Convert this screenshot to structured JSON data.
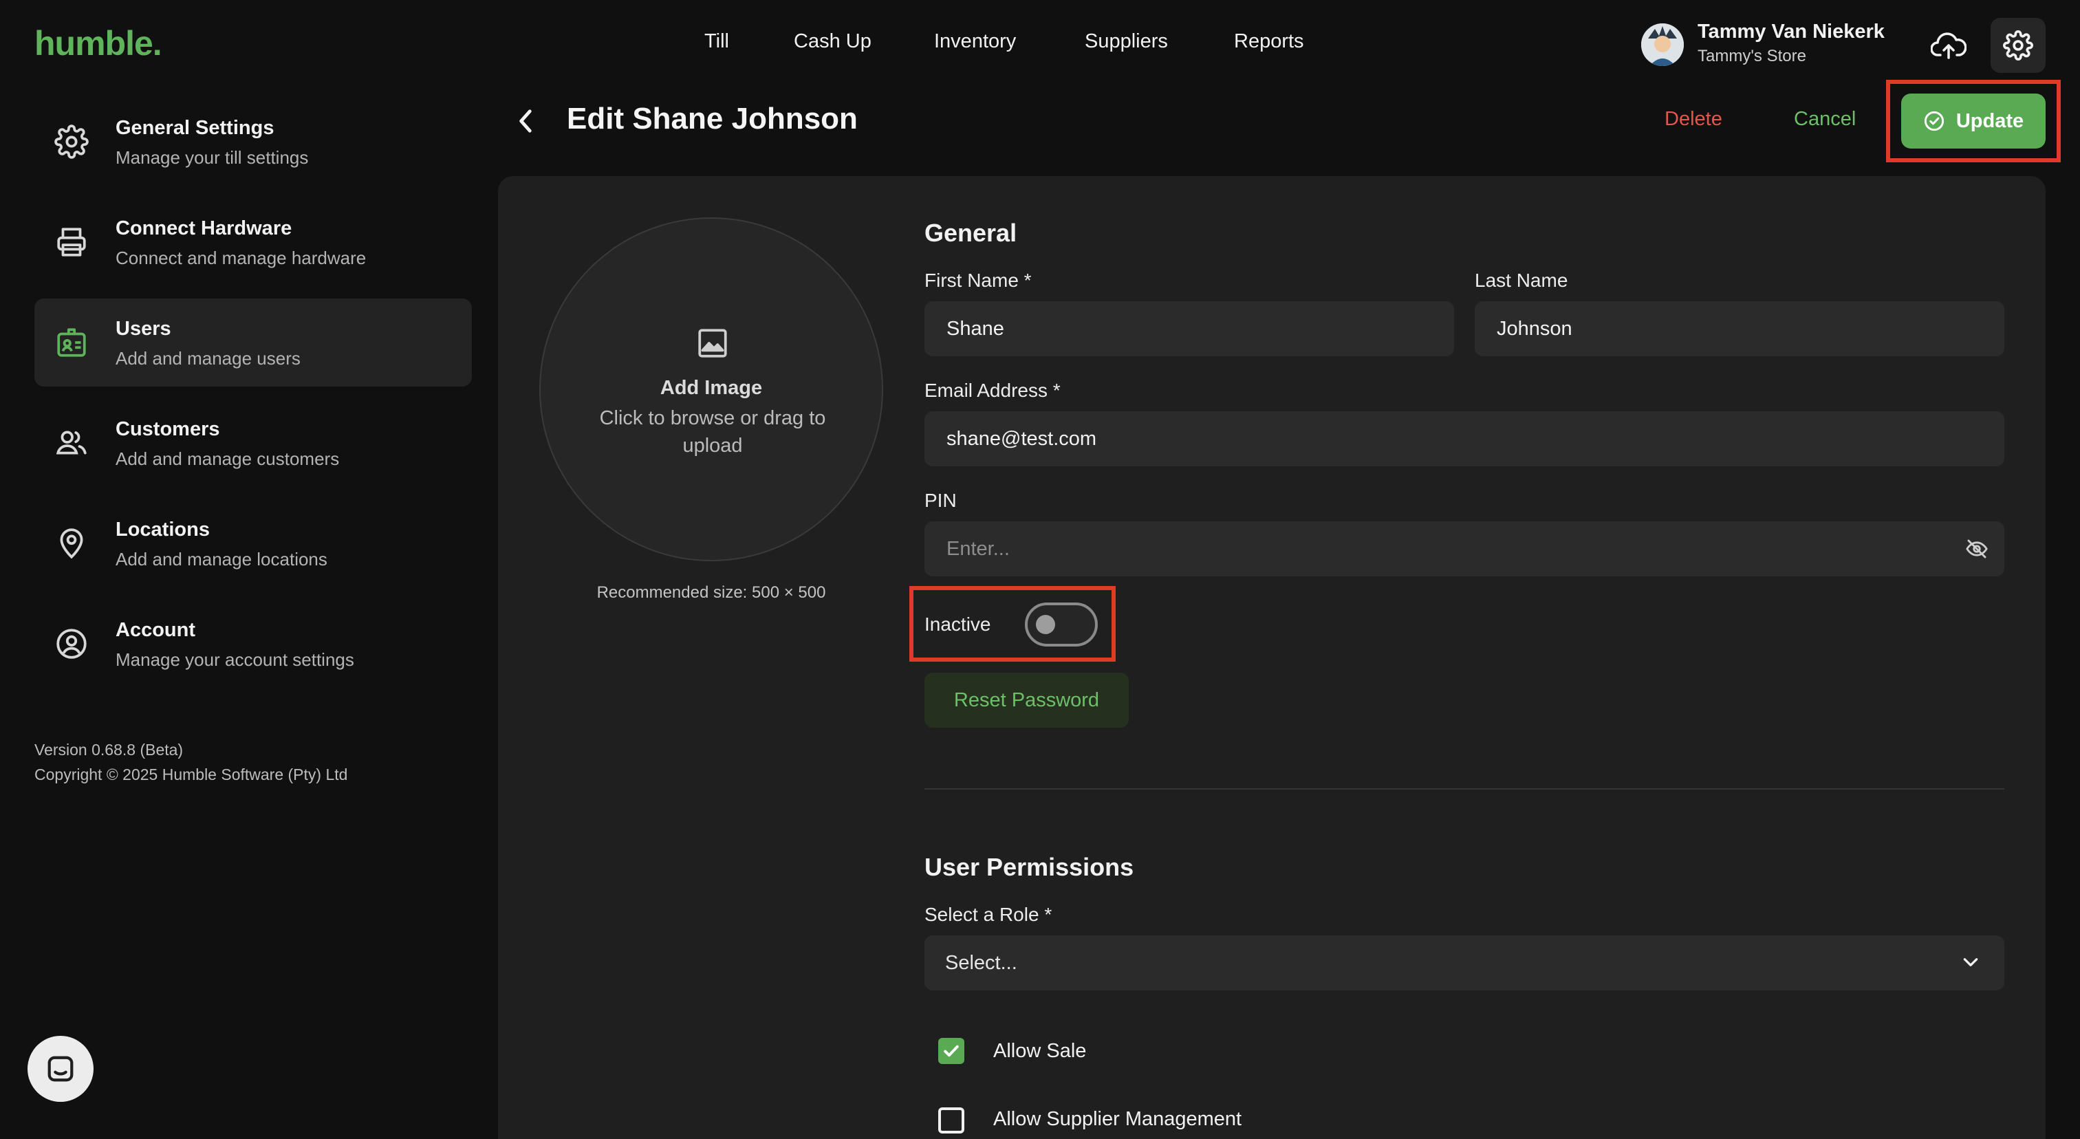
{
  "app": {
    "logo": "humble."
  },
  "nav": {
    "items": [
      "Till",
      "Cash Up",
      "Inventory",
      "Suppliers",
      "Reports"
    ]
  },
  "user": {
    "name": "Tammy Van Niekerk",
    "store": "Tammy's Store"
  },
  "sidebar": {
    "items": [
      {
        "title": "General Settings",
        "subtitle": "Manage your till settings",
        "icon": "gear-icon"
      },
      {
        "title": "Connect Hardware",
        "subtitle": "Connect and manage hardware",
        "icon": "printer-icon"
      },
      {
        "title": "Users",
        "subtitle": "Add and manage users",
        "icon": "id-card-icon",
        "active": true
      },
      {
        "title": "Customers",
        "subtitle": "Add and manage customers",
        "icon": "people-icon"
      },
      {
        "title": "Locations",
        "subtitle": "Add and manage locations",
        "icon": "location-pin-icon"
      },
      {
        "title": "Account",
        "subtitle": "Manage your account settings",
        "icon": "account-circle-icon"
      }
    ],
    "version": "Version 0.68.8 (Beta)",
    "copyright": "Copyright © 2025 Humble Software (Pty) Ltd"
  },
  "header": {
    "title": "Edit Shane Johnson",
    "delete_label": "Delete",
    "cancel_label": "Cancel",
    "update_label": "Update"
  },
  "image_upload": {
    "title": "Add Image",
    "subtitle": "Click to browse or drag to upload",
    "recommended": "Recommended size: 500 × 500"
  },
  "general": {
    "section_title": "General",
    "first_name_label": "First Name *",
    "first_name_value": "Shane",
    "last_name_label": "Last Name",
    "last_name_value": "Johnson",
    "email_label": "Email Address *",
    "email_value": "shane@test.com",
    "pin_label": "PIN",
    "pin_placeholder": "Enter...",
    "inactive_label": "Inactive",
    "inactive_on": false,
    "reset_password_label": "Reset Password"
  },
  "permissions": {
    "section_title": "User Permissions",
    "role_label": "Select a Role *",
    "role_placeholder": "Select...",
    "checkboxes": [
      {
        "label": "Allow Sale",
        "checked": true
      },
      {
        "label": "Allow Supplier Management",
        "checked": false
      }
    ]
  },
  "colors": {
    "brand": "#5fb35a",
    "danger": "#e2574c",
    "highlight": "#e03a28"
  }
}
